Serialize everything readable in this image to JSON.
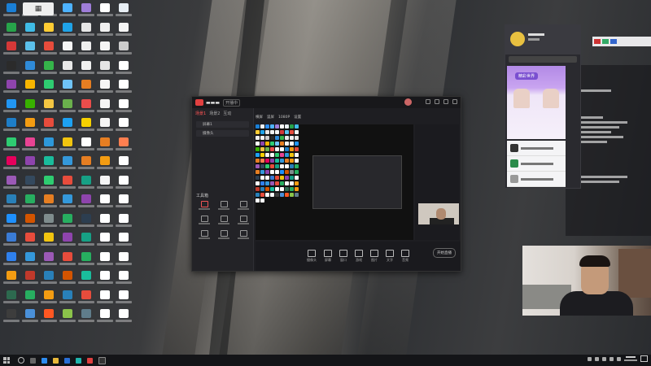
{
  "desktop": {
    "icon_colors": [
      "#1a7fd6",
      "#eef3f8",
      "#2c8df0",
      "#4db2ff",
      "#9e7dd8",
      "#ffffff",
      "#e7eef4",
      "#27a34a",
      "#3fbbe6",
      "#ffcc33",
      "#1fa3e8",
      "#e6e6e6",
      "#f0f0f0",
      "#f5f5f5",
      "#d43838",
      "#5bc0eb",
      "#e74c3c",
      "#f5f5f5",
      "#eeeeee",
      "#f5f5f5",
      "#cccccc",
      "#2b2b2b",
      "#2f8ad8",
      "#35b44a",
      "#e8e8e8",
      "#f0f0f0",
      "#e5e5e5",
      "#ffffff",
      "#8e44ad",
      "#f7b500",
      "#2ecc71",
      "#6fc3f7",
      "#e67e22",
      "#f5f5f5",
      "#ffffff",
      "#2196f3",
      "#38b000",
      "#f4c542",
      "#6ab04c",
      "#eb4d4b",
      "#f5f5f5",
      "#ffffff",
      "#1e7ec8",
      "#f39c12",
      "#e74c3c",
      "#1da1f2",
      "#f5d000",
      "#f5f5f5",
      "#ffffff",
      "#2ecc71",
      "#e84393",
      "#2d98da",
      "#f1c40f",
      "#ffffff",
      "#e67e22",
      "#ff7f50",
      "#e6005c",
      "#8e44ad",
      "#1abc9c",
      "#3498db",
      "#e67e22",
      "#f39c12",
      "#ffffff",
      "#9b59b6",
      "#34495e",
      "#2ecc71",
      "#e74c3c",
      "#16a085",
      "#f5f5f5",
      "#ffffff",
      "#2980b9",
      "#27ae60",
      "#e67e22",
      "#3498db",
      "#8e44ad",
      "#ffffff",
      "#ffffff",
      "#1e90ff",
      "#d35400",
      "#7f8c8d",
      "#27ae60",
      "#2c3e50",
      "#ffffff",
      "#ffffff",
      "#3a7bd5",
      "#e74c3c",
      "#f1c40f",
      "#8e44ad",
      "#16a085",
      "#ffffff",
      "#ffffff",
      "#2f80ed",
      "#3498db",
      "#9b59b6",
      "#e74c3c",
      "#27ae60",
      "#ffffff",
      "#ffffff",
      "#f39c12",
      "#c0392b",
      "#2980b9",
      "#d35400",
      "#1abc9c",
      "#ffffff",
      "#ffffff",
      "#2d6a4f",
      "#27ae60",
      "#f39c12",
      "#2980b9",
      "#e74c3c",
      "#ffffff",
      "#ffffff",
      "#3d3d3d",
      "#4a90d9",
      "#ff5722",
      "#8bc34a",
      "#607d8b",
      "#ffffff",
      "#ffffff"
    ]
  },
  "app": {
    "status_badge": "开播中",
    "tabs": [
      "场景1",
      "场景2",
      "互动"
    ],
    "scenes": [
      "屏幕1",
      "摄像头"
    ],
    "tools_label": "工具箱",
    "start_label": "开始直播",
    "preview_tabs": [
      "横屏",
      "竖屏",
      "1080P",
      "设置"
    ],
    "bottom_buttons": [
      "摄像头",
      "屏幕",
      "窗口",
      "游戏",
      "图片",
      "文字",
      "音频",
      "更多"
    ]
  },
  "chat": {
    "banner_label": "精彩世界"
  },
  "colors": {
    "accent": "#e04040",
    "chat_banner": "#b28ae6"
  }
}
